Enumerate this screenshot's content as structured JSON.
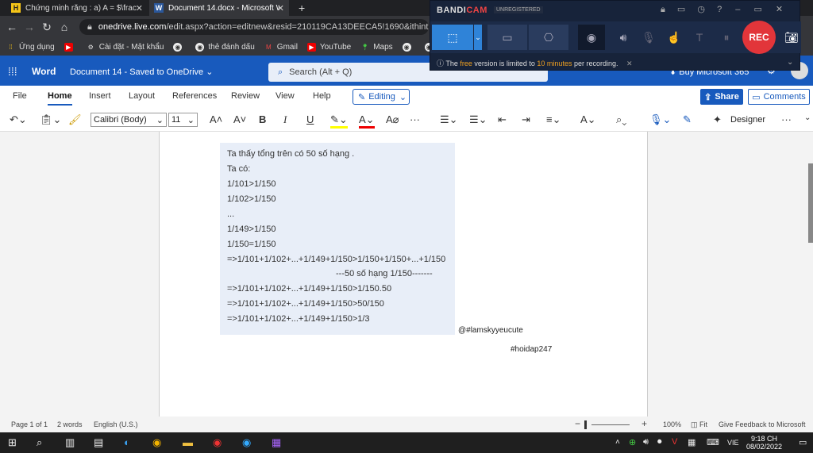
{
  "browser": {
    "tabs": [
      {
        "label": "Chứng minh rằng : a) A = $\\frac{",
        "favicon": "H",
        "active": false
      },
      {
        "label": "Document 14.docx - Microsoft W",
        "favicon": "W",
        "active": true
      }
    ],
    "new_tab": "+",
    "url_host": "onedrive.live.com",
    "url_path": "/edit.aspx?action=editnew&resid=210119CA13DEECA5!1690&ithint=fi",
    "bookmarks": [
      {
        "label": "Ứng dụng",
        "icon": "apps-grid-icon"
      },
      {
        "label": "",
        "icon": "youtube-icon"
      },
      {
        "label": "Cài đặt - Mật khẩu",
        "icon": "gear-icon"
      },
      {
        "label": "",
        "icon": "globe-icon"
      },
      {
        "label": "thẻ đánh dấu",
        "icon": "globe-icon"
      },
      {
        "label": "Gmail",
        "icon": "gmail-icon"
      },
      {
        "label": "YouTube",
        "icon": "youtube-icon"
      },
      {
        "label": "Maps",
        "icon": "maps-icon"
      }
    ]
  },
  "word": {
    "app": "Word",
    "doc": "Document 14  -  Saved to OneDrive",
    "search_placeholder": "Search (Alt + Q)",
    "buy": "Buy Microsoft 365",
    "menu": [
      "File",
      "Home",
      "Insert",
      "Layout",
      "References",
      "Review",
      "View",
      "Help"
    ],
    "editing": "Editing",
    "share": "Share",
    "comments": "Comments",
    "font": "Calibri (Body)",
    "size": "11",
    "designer": "Designer"
  },
  "document": {
    "lines": [
      "Ta thấy tổng trên có 50 số hạng .",
      "Ta có:",
      "1/101>1/150",
      "1/102>1/150",
      "...",
      "1/149>1/150",
      "1/150=1/150",
      "=>1/101+1/102+...+1/149+1/150>1/150+1/150+...+1/150",
      "---50 số hạng 1/150-------",
      "=>1/101+1/102+...+1/149+1/150>1/150.50",
      "=>1/101+1/102+...+1/149+1/150>50/150",
      "=>1/101+1/102+...+1/149+1/150>1/3"
    ],
    "tag1": "@#lamskyyeucute",
    "tag2": "#hoidap247"
  },
  "status": {
    "page": "Page 1 of 1",
    "words": "2 words",
    "lang": "English (U.S.)",
    "zoom": "100%",
    "fit": "Fit",
    "feedback": "Give Feedback to Microsoft",
    "zoom_level": 0.2
  },
  "taskbar": {
    "lang": "VIE",
    "time": "9:18 CH",
    "date": "08/02/2022"
  },
  "bandicam": {
    "title_a": "BANDI",
    "title_b": "CAM",
    "unreg": "UNREGISTERED",
    "rec": "REC",
    "notice_a": "The ",
    "notice_free": "free",
    "notice_b": " version is limited to ",
    "notice_limit": "10 minutes",
    "notice_c": " per recording."
  },
  "colors": {
    "word_blue": "#185abd",
    "rec_red": "#e2353a"
  }
}
